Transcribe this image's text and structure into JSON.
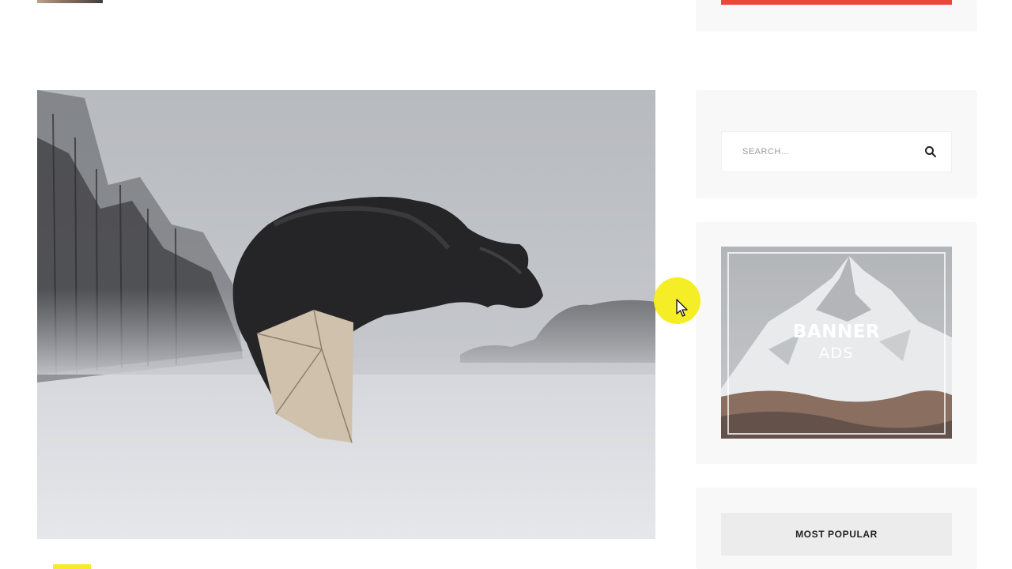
{
  "search": {
    "placeholder": "SEARCH..."
  },
  "banner": {
    "title": "BANNER",
    "subtitle": "ADS"
  },
  "popular": {
    "title": "MOST POPULAR"
  },
  "icons": {
    "search": "search-icon",
    "cursor": "mouse-cursor-icon"
  },
  "colors": {
    "accent_red": "#e9493b",
    "highlight_yellow": "#f7ea2c",
    "widget_bg": "#f8f8f8",
    "popular_header_bg": "#ececec"
  }
}
